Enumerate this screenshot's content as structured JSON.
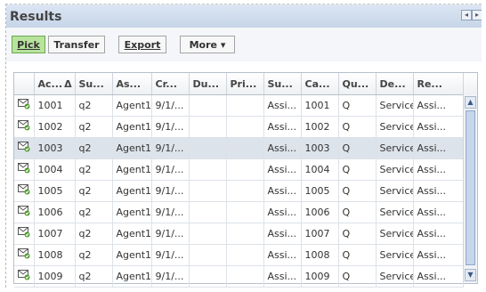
{
  "panel": {
    "title": "Results"
  },
  "toolbar": {
    "pick": "Pick",
    "transfer": "Transfer",
    "export": "Export",
    "more": "More",
    "more_arrow": "▾"
  },
  "table": {
    "sort_indicator": "Δ",
    "columns": [
      "Ac...",
      "Su...",
      "As...",
      "Cr...",
      "Du...",
      "Pri...",
      "Su...",
      "Ca...",
      "Qu...",
      "De...",
      "Re..."
    ],
    "rows": [
      [
        "1001",
        "q2",
        "Agent1",
        "9/1/...",
        "",
        "",
        "Assi...",
        "1001",
        "Q",
        "Service",
        "Assi..."
      ],
      [
        "1002",
        "q2",
        "Agent1",
        "9/1/...",
        "",
        "",
        "Assi...",
        "1002",
        "Q",
        "Service",
        "Assi..."
      ],
      [
        "1003",
        "q2",
        "Agent1",
        "9/1/...",
        "",
        "",
        "Assi...",
        "1003",
        "Q",
        "Service",
        "Assi..."
      ],
      [
        "1004",
        "q2",
        "Agent1",
        "9/1/...",
        "",
        "",
        "Assi...",
        "1004",
        "Q",
        "Service",
        "Assi..."
      ],
      [
        "1005",
        "q2",
        "Agent1",
        "9/1/...",
        "",
        "",
        "Assi...",
        "1005",
        "Q",
        "Service",
        "Assi..."
      ],
      [
        "1006",
        "q2",
        "Agent1",
        "9/1/...",
        "",
        "",
        "Assi...",
        "1006",
        "Q",
        "Service",
        "Assi..."
      ],
      [
        "1007",
        "q2",
        "Agent1",
        "9/1/...",
        "",
        "",
        "Assi...",
        "1007",
        "Q",
        "Service",
        "Assi..."
      ],
      [
        "1008",
        "q2",
        "Agent1",
        "9/1/...",
        "",
        "",
        "Assi...",
        "1008",
        "Q",
        "Service",
        "Assi..."
      ],
      [
        "1009",
        "q2",
        "Agent1",
        "9/1/...",
        "",
        "",
        "Assi...",
        "1009",
        "Q",
        "Service",
        "Assi..."
      ]
    ],
    "selected_row": 2,
    "row_icon": "mail-accept-icon"
  },
  "colors": {
    "active_button": "#b8e39d",
    "selected_row": "#dde3ea",
    "header_bar": "#c6d5e9"
  }
}
